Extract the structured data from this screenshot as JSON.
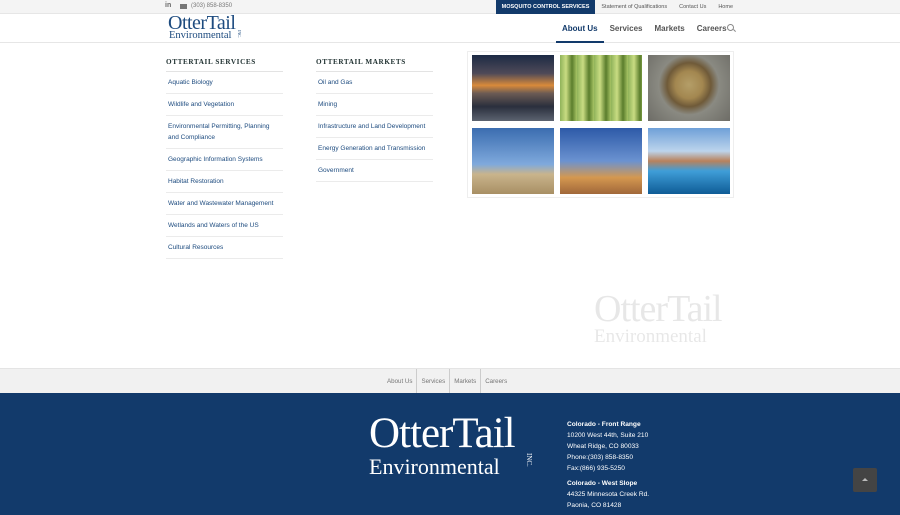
{
  "topbar": {
    "linkedin": "in",
    "phone": "(303) 858-8350",
    "quicklinks": [
      "MOSQUITO CONTROL SERVICES",
      "Statement of Qualifications",
      "Contact Us",
      "Home"
    ]
  },
  "header": {
    "logo_line1": "OtterTail",
    "logo_line2": "Environmental",
    "logo_inc": "INC.",
    "nav": [
      "About Us",
      "Services",
      "Markets",
      "Careers"
    ],
    "active_nav": "About Us"
  },
  "services": {
    "title": "OTTERTAIL SERVICES",
    "items": [
      "Aquatic Biology",
      "Wildlife and Vegetation",
      "Environmental Permitting, Planning and Compliance",
      "Geographic Information Systems",
      "Habitat Restoration",
      "Water and Wastewater Management",
      "Wetlands and Waters of the US",
      "Cultural Resources"
    ]
  },
  "markets": {
    "title": "OTTERTAIL MARKETS",
    "items": [
      "Oil and Gas",
      "Mining",
      "Infrastructure and Land Development",
      "Energy Generation and Transmission",
      "Government"
    ]
  },
  "footer_nav": [
    "About Us",
    "Services",
    "Markets",
    "Careers"
  ],
  "footer": {
    "logo_line1": "OtterTail",
    "logo_line2": "Environmental",
    "logo_inc": "INC.",
    "office1": {
      "name": "Colorado - Front Range",
      "street": "10200 West 44th, Suite 210",
      "city": "Wheat Ridge, CO 80033",
      "phone": "Phone:(303) 858-8350",
      "fax": "Fax:(866) 935-5250"
    },
    "office2": {
      "name": "Colorado - West Slope",
      "street": "44325 Minnesota Creek Rd.",
      "city": "Paonia, CO 81428"
    }
  },
  "colors": {
    "brand": "#123a6b",
    "link": "#1d4b7f"
  }
}
